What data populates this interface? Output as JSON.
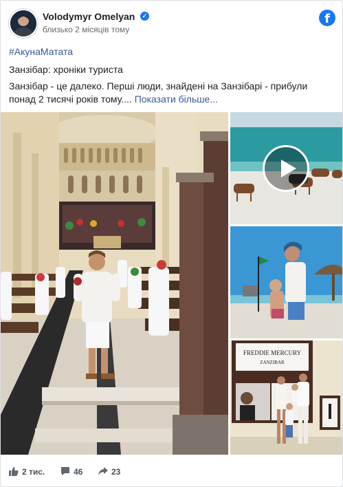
{
  "post": {
    "author": "Volodymyr Omelyan",
    "timestamp": "близько 2 місяців тому",
    "hashtag": "#АкунаМатата",
    "subtitle": "Занзібар: хроніки туриста",
    "text": "Занзібар - це далеко. Перші люди, знайдені на Занзібарі - прибули понад 2 тисячі років тому.... ",
    "see_more": "Показати більше..."
  },
  "photos": {
    "mercury_sign_line1": "FREDDIE MERCURY",
    "mercury_sign_line2": "ZANZIBAR"
  },
  "stats": {
    "likes": "2 тис.",
    "comments": "46",
    "shares": "23"
  },
  "colors": {
    "brand": "#1877f2",
    "link": "#385898",
    "meta": "#65676b"
  },
  "icons": [
    "verified-icon",
    "facebook-logo",
    "play-icon",
    "like-icon",
    "comment-icon",
    "share-icon"
  ]
}
